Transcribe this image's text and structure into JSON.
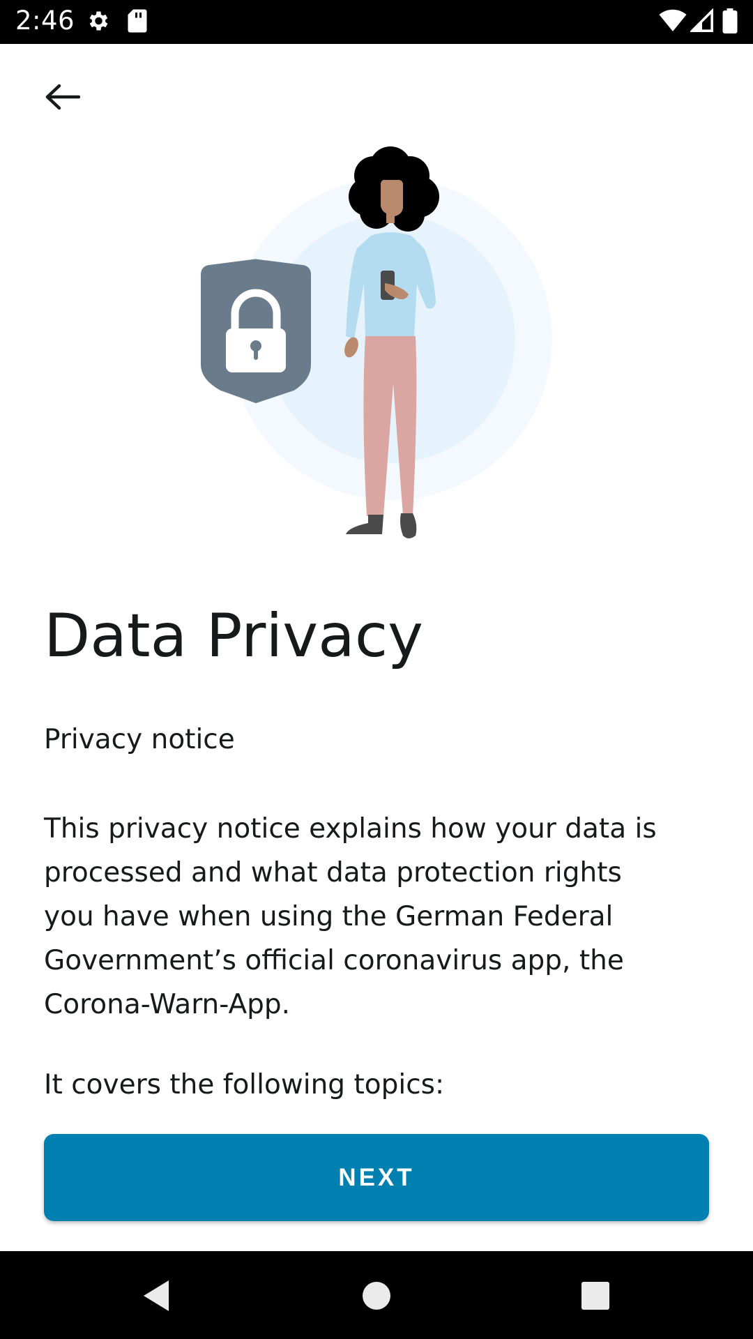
{
  "status_bar": {
    "time": "2:46",
    "icons": [
      "settings-icon",
      "sd-card-icon",
      "wifi-icon",
      "signal-icon",
      "battery-icon"
    ]
  },
  "header": {
    "back_icon": "arrow-left-icon"
  },
  "page": {
    "title": "Data Privacy",
    "subtitle": "Privacy notice",
    "body": "This privacy notice explains how your data is processed and what data protection rights you have when using the German Federal Government’s official coronavirus app, the Corona-Warn-App.",
    "body_2": "It covers the following topics:"
  },
  "footer": {
    "next_label": "NEXT"
  },
  "colors": {
    "accent": "#0080b0",
    "shield": "#6a7b8b",
    "circle_outer": "#f3f9fe",
    "circle_inner": "#e6f3fc"
  },
  "nav_bar": {
    "icons": [
      "back-triangle-icon",
      "home-circle-icon",
      "recents-square-icon"
    ]
  }
}
